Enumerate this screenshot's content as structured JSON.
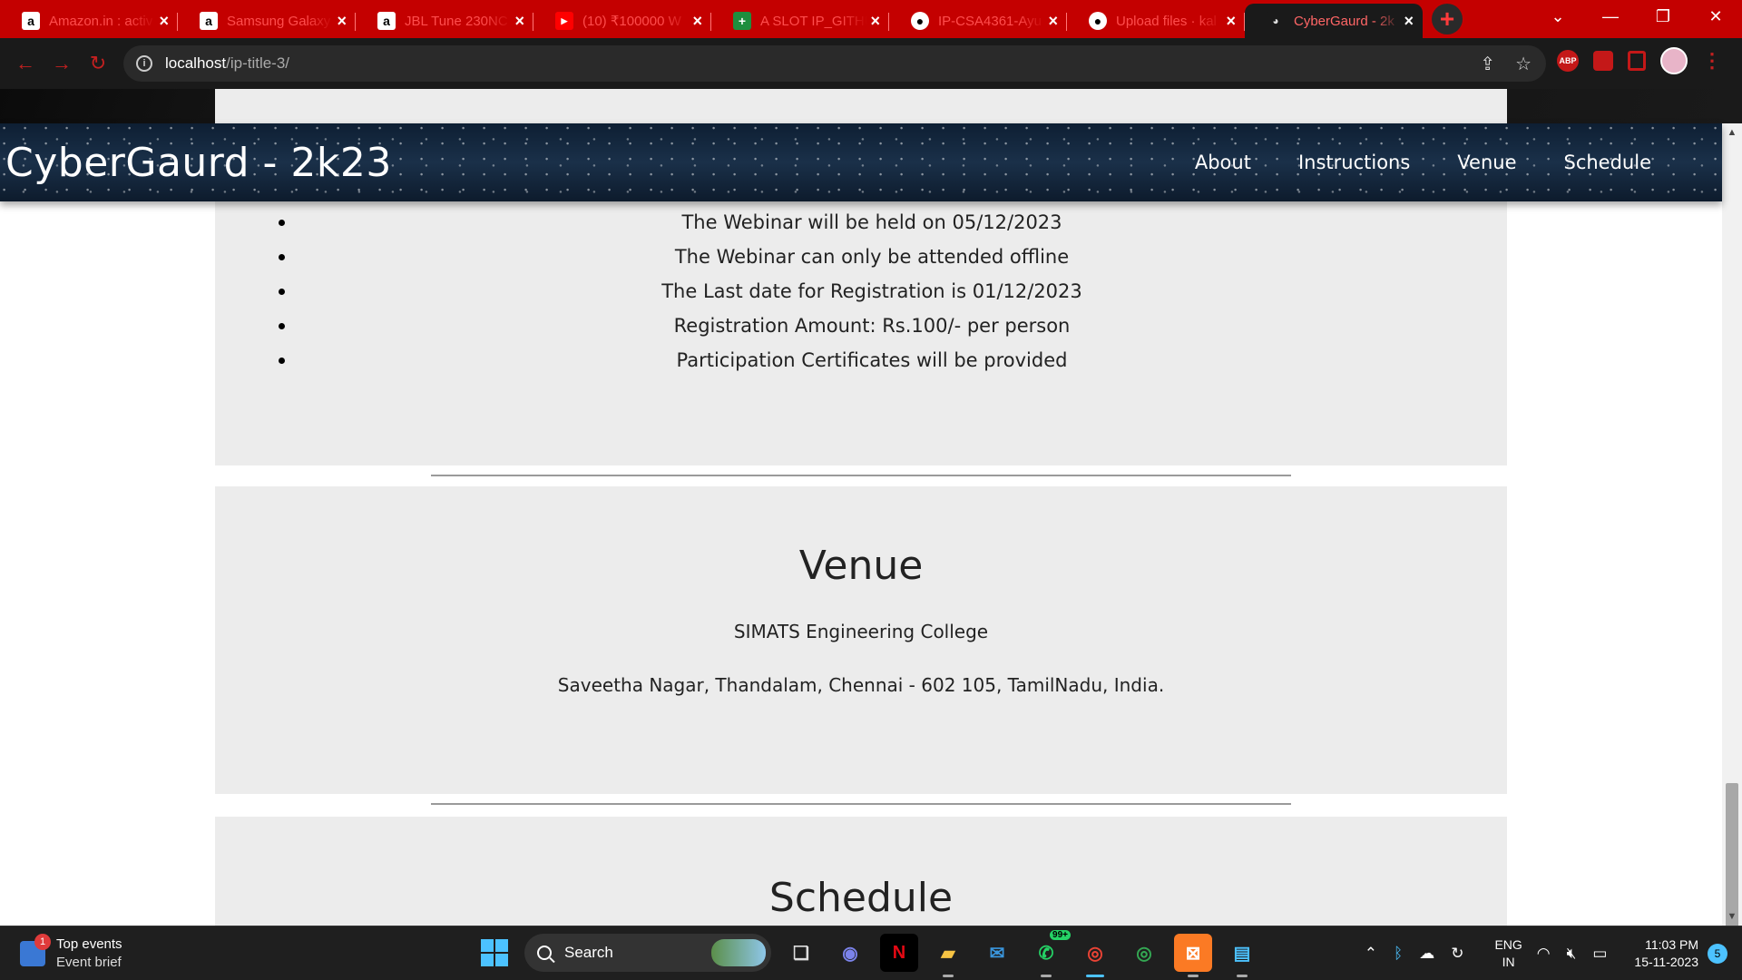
{
  "browser": {
    "tabs": [
      {
        "title": "Amazon.in : activ",
        "favicon": "amazon-icon"
      },
      {
        "title": "Samsung Galaxy",
        "favicon": "amazon-icon"
      },
      {
        "title": "JBL Tune 230NC",
        "favicon": "amazon-icon"
      },
      {
        "title": "(10) ₹100000 W",
        "favicon": "youtube-icon"
      },
      {
        "title": "A SLOT IP_GITHU",
        "favicon": "sheets-icon"
      },
      {
        "title": "IP-CSA4361-Ayu",
        "favicon": "github-icon"
      },
      {
        "title": "Upload files · kal",
        "favicon": "github-icon"
      },
      {
        "title": "CyberGaurd - 2k",
        "favicon": "cybergaurd-icon",
        "active": true
      }
    ],
    "url_host": "localhost",
    "url_path": "/ip-title-3/",
    "extensions": {
      "abp_label": "ABP"
    },
    "accent": "#c40000"
  },
  "site": {
    "brand": "CyberGaurd - 2k23",
    "nav": [
      "About",
      "Instructions",
      "Venue",
      "Schedule"
    ],
    "instructions": [
      "The Webinar will be held on 05/12/2023",
      "The Webinar can only be attended offline",
      "The Last date for Registration is 01/12/2023",
      "Registration Amount: Rs.100/- per person",
      "Participation Certificates will be provided"
    ],
    "venue": {
      "title": "Venue",
      "line1": "SIMATS Engineering College",
      "line2": "Saveetha Nagar, Thandalam, Chennai - 602 105, TamilNadu, India."
    },
    "schedule": {
      "title": "Schedule"
    }
  },
  "taskbar": {
    "widget_title": "Top events",
    "widget_sub": "Event brief",
    "widget_badge": "1",
    "search_placeholder": "Search",
    "whatsapp_badge": "99+",
    "lang_line1": "ENG",
    "lang_line2": "IN",
    "time": "11:03 PM",
    "date": "15-11-2023",
    "notification_count": "5"
  }
}
